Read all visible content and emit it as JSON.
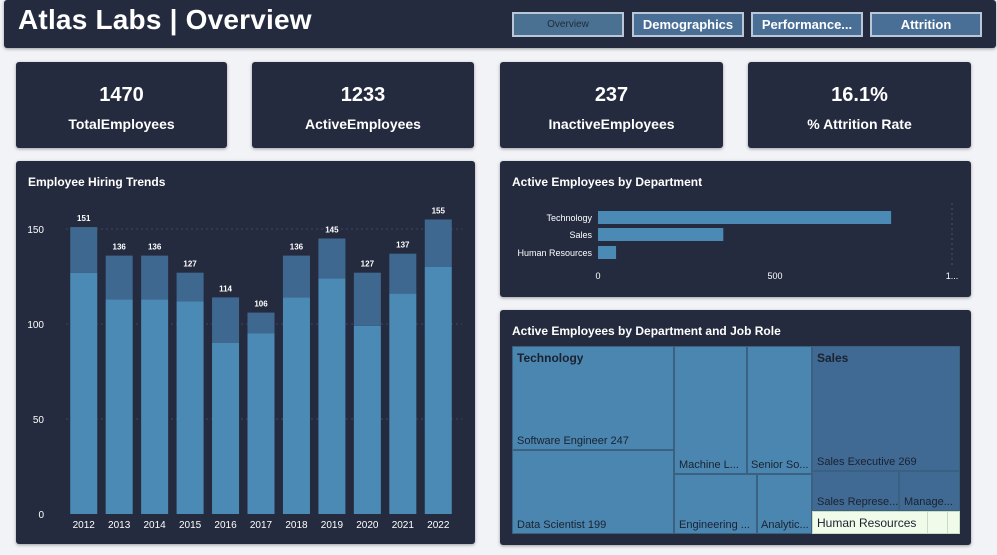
{
  "header": {
    "title": "Atlas Labs | Overview",
    "nav": [
      {
        "label": "Overview",
        "active": true
      },
      {
        "label": "Demographics",
        "active": false
      },
      {
        "label": "Performance...",
        "active": false
      },
      {
        "label": "Attrition",
        "active": false
      }
    ]
  },
  "kpis": [
    {
      "value": "1470",
      "label": "TotalEmployees"
    },
    {
      "value": "1233",
      "label": "ActiveEmployees"
    },
    {
      "value": "237",
      "label": "InactiveEmployees"
    },
    {
      "value": "16.1%",
      "label": "% Attrition Rate"
    }
  ],
  "colors": {
    "background": "#f2f3f7",
    "panel": "#252b3f",
    "bar_dark": "#3f6890",
    "bar_light": "#4b8ab5",
    "hr_cell": "#f0fbea"
  },
  "hiring_chart": {
    "title": "Employee Hiring Trends",
    "chart_data": {
      "type": "bar",
      "stacked": true,
      "categories": [
        "2012",
        "2013",
        "2014",
        "2015",
        "2016",
        "2017",
        "2018",
        "2019",
        "2020",
        "2021",
        "2022"
      ],
      "totals": [
        151,
        136,
        136,
        127,
        114,
        106,
        136,
        145,
        127,
        137,
        155
      ],
      "series": [
        {
          "values": [
            127,
            113,
            113,
            112,
            90,
            95,
            114,
            124,
            99,
            116,
            130
          ]
        },
        {
          "values": [
            24,
            23,
            23,
            15,
            24,
            11,
            22,
            21,
            28,
            21,
            25
          ]
        }
      ],
      "yticks": [
        "0",
        "50",
        "100",
        "150"
      ],
      "ylim": [
        0,
        160
      ]
    }
  },
  "dept_chart": {
    "title": "Active Employees by Department",
    "chart_data": {
      "type": "bar",
      "orientation": "horizontal",
      "categories": [
        "Technology",
        "Sales",
        "Human Resources"
      ],
      "values": [
        828,
        354,
        51
      ],
      "xticks": [
        "0",
        "500",
        "1..."
      ],
      "xlim": [
        0,
        1000
      ]
    }
  },
  "treemap": {
    "title": "Active Employees by Department and Job Role",
    "groups": [
      "Technology",
      "Sales",
      "Human Resources"
    ],
    "cells": [
      {
        "label": "Software Engineer 247"
      },
      {
        "label": "Data Scientist 199"
      },
      {
        "label": "Machine L..."
      },
      {
        "label": "Senior So..."
      },
      {
        "label": "Engineering ..."
      },
      {
        "label": "Analytic..."
      },
      {
        "label": "Sales Executive 269"
      },
      {
        "label": "Sales Represe..."
      },
      {
        "label": "Manage..."
      }
    ]
  }
}
